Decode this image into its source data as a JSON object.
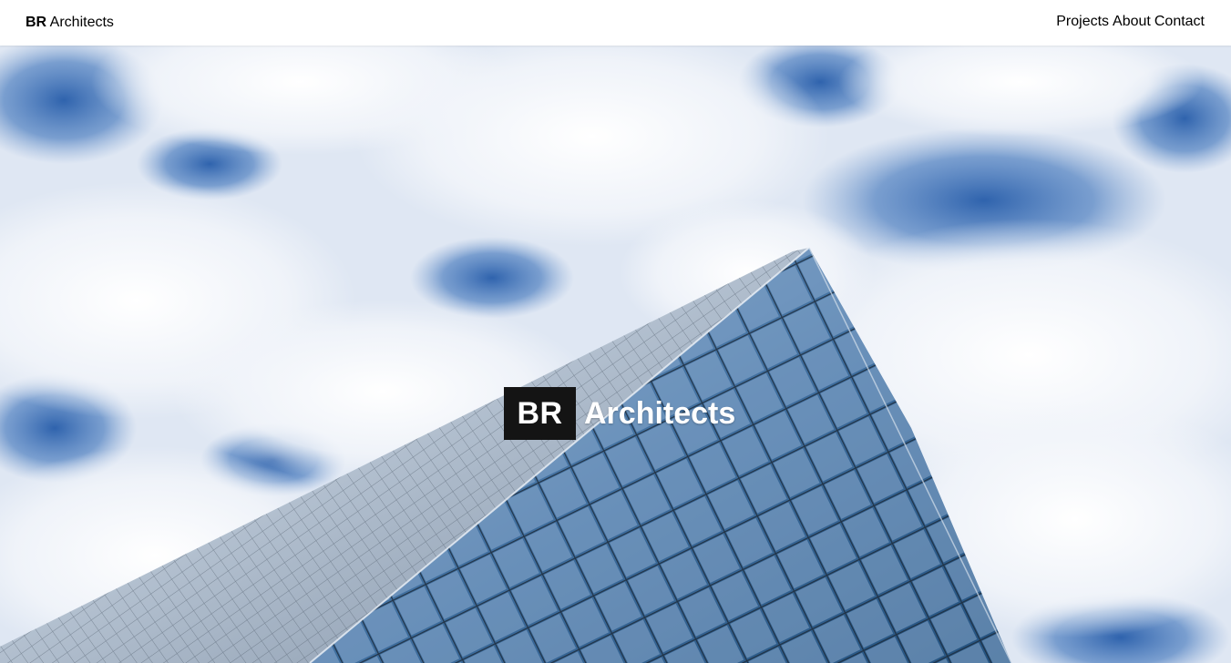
{
  "header": {
    "brand_bold": "BR",
    "brand_text": "Architects",
    "nav": [
      {
        "label": "Projects"
      },
      {
        "label": "About"
      },
      {
        "label": "Contact"
      }
    ]
  },
  "hero": {
    "mark": "BR",
    "word": "Architects",
    "colors": {
      "sky": "#3f6fb3",
      "cloud": "#f4f6fa",
      "glass_dark": "#2c5d8e",
      "glass_light": "#a9c3df"
    }
  }
}
